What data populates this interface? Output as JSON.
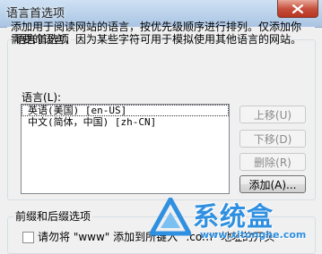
{
  "window": {
    "title": "语言首选项",
    "close_icon": "close-x-icon"
  },
  "group_language": {
    "label": "语言首选项",
    "description": "添加用于阅读网站的语言，按优先级顺序进行排列。仅添加你需要的语言，因为某些字符可用于模拟使用其他语言的网站。",
    "list_label": "语言(L):",
    "items": [
      {
        "text": "英语(美国) [en-US]"
      },
      {
        "text": "中文(简体，中国) [zh-CN]"
      }
    ],
    "buttons": {
      "move_up": "上移(U)",
      "move_down": "下移(D)",
      "remove": "删除(R)",
      "add": "添加(A)..."
    }
  },
  "group_prefix": {
    "label": "前缀和后缀选项",
    "checkbox_text": "请勿将 \"www\" 添加到所键入 \".com\" 地址的开头"
  },
  "watermark": {
    "text": "系统盒",
    "url": "www.xitonghe.com",
    "logo_icon": "triangle-logo-icon"
  },
  "colors": {
    "title_bar": "#b9d1ea",
    "close_button": "#c7523f",
    "watermark": "#2f8fe0"
  }
}
